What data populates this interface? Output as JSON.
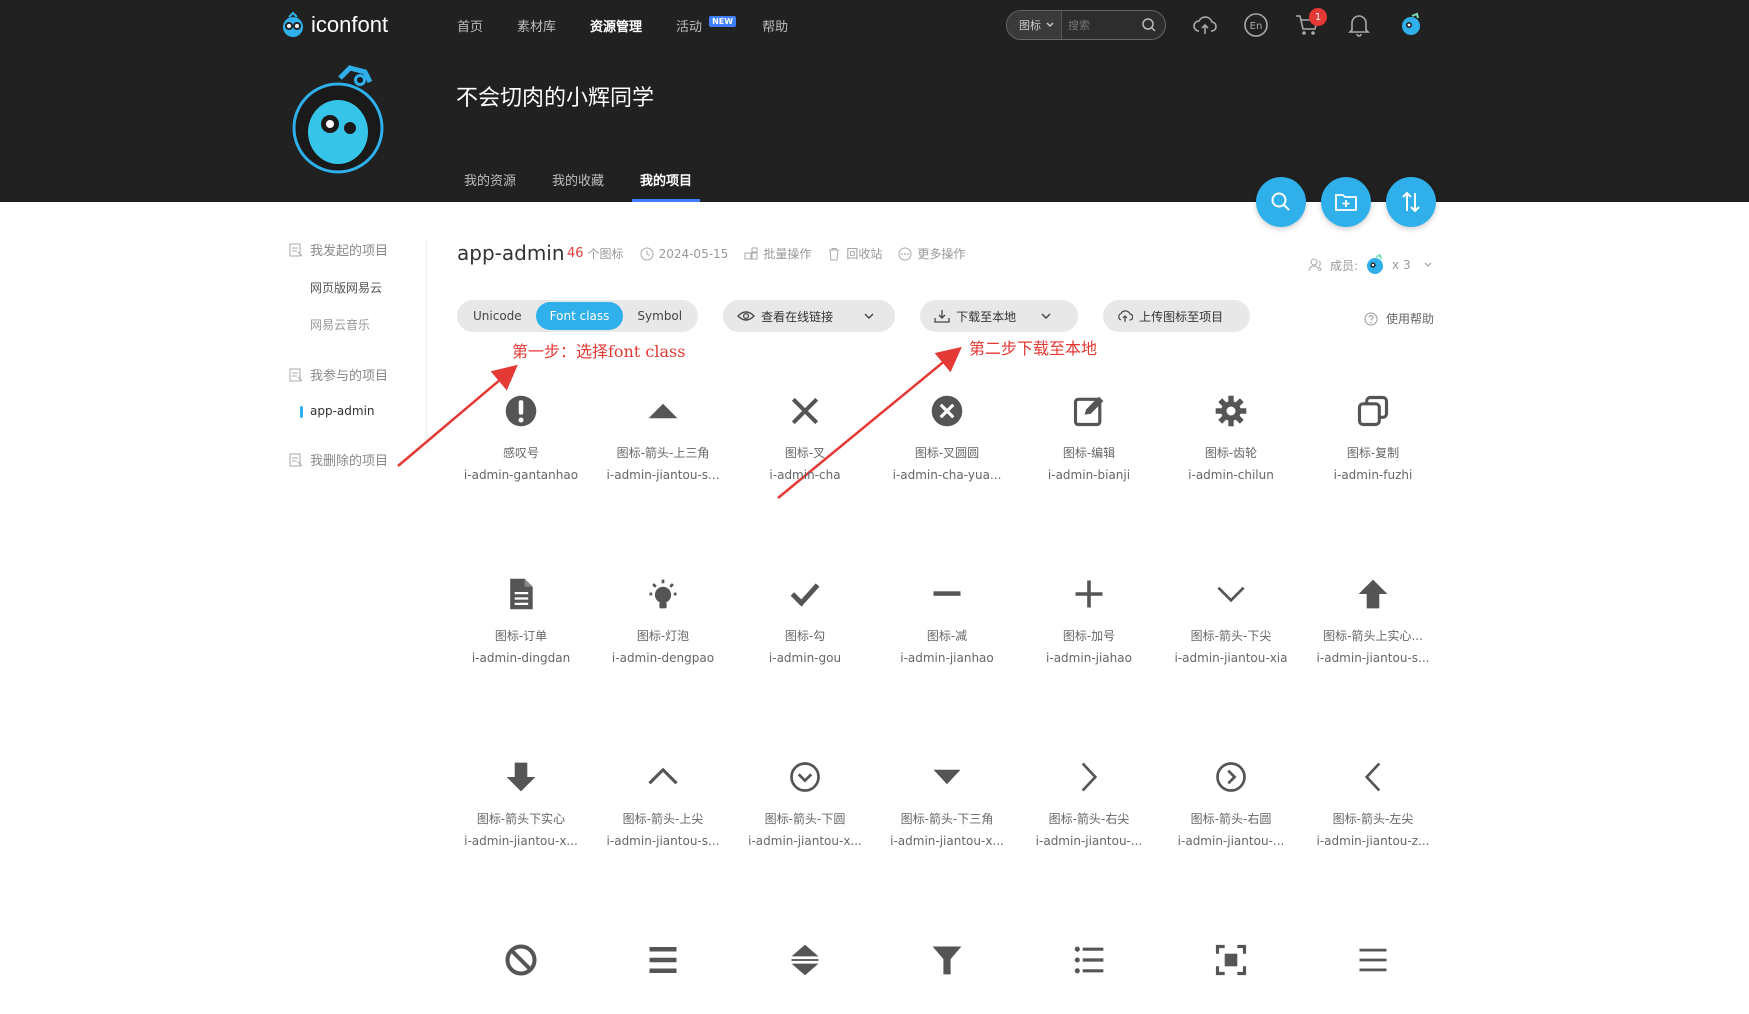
{
  "header": {
    "logo_text": "iconfont",
    "nav": [
      {
        "label": "首页"
      },
      {
        "label": "素材库"
      },
      {
        "label": "资源管理",
        "active": true
      },
      {
        "label": "活动",
        "badge": "NEW"
      },
      {
        "label": "帮助"
      }
    ],
    "search": {
      "type": "图标",
      "placeholder": "搜索"
    },
    "cart_count": "1",
    "user_name": "不会切肉的小辉同学",
    "tabs": [
      {
        "label": "我的资源"
      },
      {
        "label": "我的收藏"
      },
      {
        "label": "我的项目",
        "active": true
      }
    ]
  },
  "sidebar": {
    "sections": [
      {
        "title": "我发起的项目",
        "items": [
          "网页版网易云",
          "网易云音乐"
        ]
      },
      {
        "title": "我参与的项目",
        "items": [
          "app-admin"
        ]
      },
      {
        "title": "我删除的项目",
        "items": []
      }
    ]
  },
  "project": {
    "name": "app-admin",
    "icon_count": "46",
    "icon_count_unit": "个图标",
    "date": "2024-05-15",
    "batch": "批量操作",
    "recycle": "回收站",
    "more": "更多操作",
    "members_label": "成员:",
    "members_count": "x 3"
  },
  "toolbar": {
    "formats": [
      "Unicode",
      "Font class",
      "Symbol"
    ],
    "active_format": "Font class",
    "view_online": "查看在线链接",
    "download": "下载至本地",
    "upload": "上传图标至项目",
    "help": "使用帮助"
  },
  "annotations": {
    "step1": "第一步：选择font class",
    "step2": "第二步下载至本地"
  },
  "icons": [
    {
      "name": "感叹号",
      "cls": "i-admin-gantanhao",
      "glyph": "exclamation-icon"
    },
    {
      "name": "图标-箭头-上三角",
      "cls": "i-admin-jiantou-s...",
      "glyph": "triangle-up-icon"
    },
    {
      "name": "图标-叉",
      "cls": "i-admin-cha",
      "glyph": "cross-icon"
    },
    {
      "name": "图标-叉圆圆",
      "cls": "i-admin-cha-yua...",
      "glyph": "cross-circle-icon"
    },
    {
      "name": "图标-编辑",
      "cls": "i-admin-bianji",
      "glyph": "edit-icon"
    },
    {
      "name": "图标-齿轮",
      "cls": "i-admin-chilun",
      "glyph": "gear-icon"
    },
    {
      "name": "图标-复制",
      "cls": "i-admin-fuzhi",
      "glyph": "copy-icon"
    },
    {
      "name": "图标-订单",
      "cls": "i-admin-dingdan",
      "glyph": "document-icon"
    },
    {
      "name": "图标-灯泡",
      "cls": "i-admin-dengpao",
      "glyph": "bulb-icon"
    },
    {
      "name": "图标-勾",
      "cls": "i-admin-gou",
      "glyph": "check-icon"
    },
    {
      "name": "图标-减",
      "cls": "i-admin-jianhao",
      "glyph": "minus-icon"
    },
    {
      "name": "图标-加号",
      "cls": "i-admin-jiahao",
      "glyph": "plus-icon"
    },
    {
      "name": "图标-箭头-下尖",
      "cls": "i-admin-jiantou-xia",
      "glyph": "chevron-down-icon"
    },
    {
      "name": "图标-箭头上实心...",
      "cls": "i-admin-jiantou-s...",
      "glyph": "arrow-up-solid-icon"
    },
    {
      "name": "图标-箭头下实心",
      "cls": "i-admin-jiantou-x...",
      "glyph": "arrow-down-solid-icon"
    },
    {
      "name": "图标-箭头-上尖",
      "cls": "i-admin-jiantou-s...",
      "glyph": "chevron-up-icon"
    },
    {
      "name": "图标-箭头-下圆",
      "cls": "i-admin-jiantou-x...",
      "glyph": "chevron-down-circle-icon"
    },
    {
      "name": "图标-箭头-下三角",
      "cls": "i-admin-jiantou-x...",
      "glyph": "triangle-down-icon"
    },
    {
      "name": "图标-箭头-右尖",
      "cls": "i-admin-jiantou-...",
      "glyph": "chevron-right-icon"
    },
    {
      "name": "图标-箭头-右圆",
      "cls": "i-admin-jiantou-...",
      "glyph": "chevron-right-circle-icon"
    },
    {
      "name": "图标-箭头-左尖",
      "cls": "i-admin-jiantou-z...",
      "glyph": "chevron-left-icon"
    },
    {
      "name": "",
      "cls": "",
      "glyph": "forbidden-icon"
    },
    {
      "name": "",
      "cls": "",
      "glyph": "menu-thick-icon"
    },
    {
      "name": "",
      "cls": "",
      "glyph": "sort-icon"
    },
    {
      "name": "",
      "cls": "",
      "glyph": "filter-icon"
    },
    {
      "name": "",
      "cls": "",
      "glyph": "list-icon"
    },
    {
      "name": "",
      "cls": "",
      "glyph": "fullscreen-icon"
    },
    {
      "name": "",
      "cls": "",
      "glyph": "menu-icon"
    }
  ],
  "colors": {
    "accent": "#2fb0ea",
    "header_bg": "#212121",
    "annotation": "#e53935",
    "icon": "#555555"
  }
}
